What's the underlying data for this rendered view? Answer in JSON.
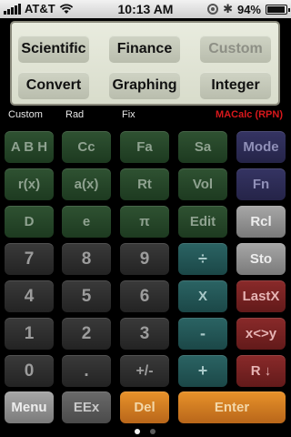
{
  "status_bar": {
    "carrier": "AT&T",
    "time": "10:13 AM",
    "battery": "94%",
    "battery_level": 0.94
  },
  "mode_buttons": [
    {
      "label": "Scientific"
    },
    {
      "label": "Finance"
    },
    {
      "label": "Custom"
    },
    {
      "label": "Convert"
    },
    {
      "label": "Graphing"
    },
    {
      "label": "Integer"
    }
  ],
  "status_line": {
    "mode": "Custom",
    "angle": "Rad",
    "format": "Fix",
    "brand": "MACalc (RPN)"
  },
  "keypad": {
    "row1": [
      "A B H",
      "Cc",
      "Fa",
      "Sa",
      "Mode"
    ],
    "row2": [
      "r(x)",
      "a(x)",
      "Rt",
      "Vol",
      "Fn"
    ],
    "row3": [
      "D",
      "e",
      "π",
      "Edit",
      "Rcl"
    ],
    "row4": [
      "7",
      "8",
      "9",
      "÷",
      "Sto"
    ],
    "row5": [
      "4",
      "5",
      "6",
      "X",
      "LastX"
    ],
    "row6": [
      "1",
      "2",
      "3",
      "-",
      "x<>y"
    ],
    "row7": [
      "0",
      ".",
      "+/-",
      "+",
      "R ↓"
    ],
    "row8": [
      "Menu",
      "EEx",
      "Del",
      "Enter"
    ]
  },
  "page_indicator": {
    "pages": 2,
    "current": 1
  },
  "colors": {
    "function_key": "#2f5232",
    "mode_key": "#353463",
    "digit_key": "#2e2e2e",
    "operator_key": "#2b6464",
    "stack_key": "#8a2a2a",
    "enter_key": "#e8922a"
  }
}
